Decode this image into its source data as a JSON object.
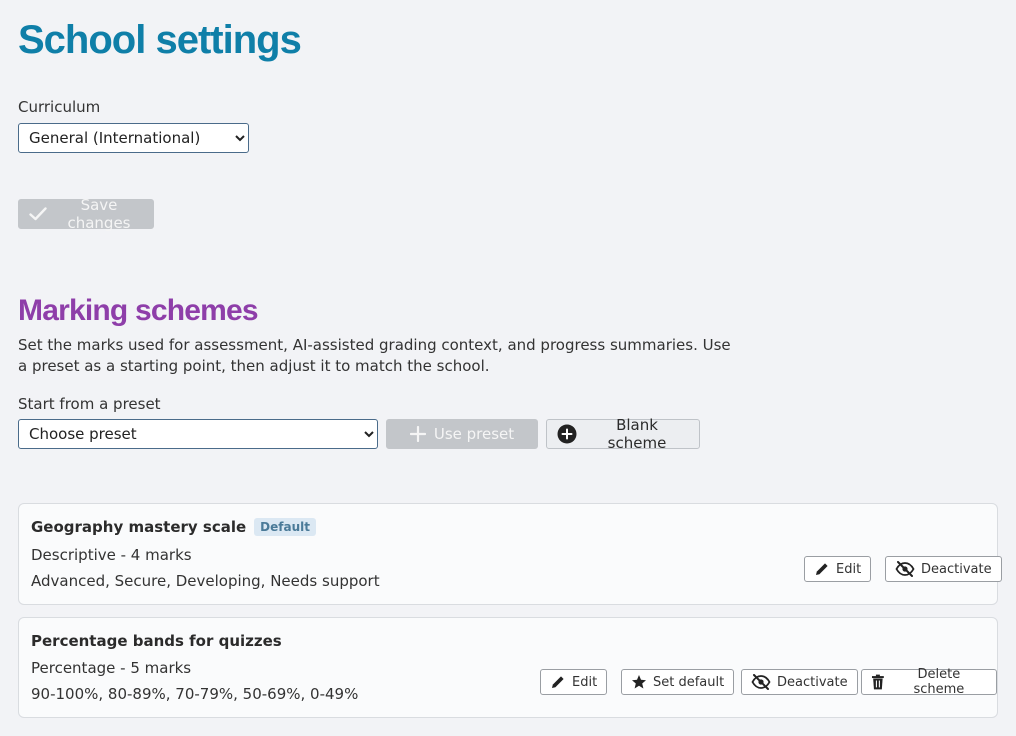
{
  "page": {
    "title": "School settings"
  },
  "curriculum": {
    "label": "Curriculum",
    "selected": "General (International)"
  },
  "save_button": {
    "label": "Save changes"
  },
  "marking": {
    "title": "Marking schemes",
    "description": "Set the marks used for assessment, AI-assisted grading context, and progress summaries. Use a preset as a starting point, then adjust it to match the school.",
    "preset_label": "Start from a preset",
    "preset_selected": "Choose preset",
    "use_preset_label": "Use preset",
    "blank_scheme_label": "Blank scheme"
  },
  "schemes": [
    {
      "name": "Geography mastery scale",
      "badge": "Default",
      "type": "Descriptive - 4 marks",
      "marks": "Advanced, Secure, Developing, Needs support",
      "edit_label": "Edit",
      "deactivate_label": "Deactivate"
    },
    {
      "name": "Percentage bands for quizzes",
      "type": "Percentage - 5 marks",
      "marks": "90-100%, 80-89%, 70-79%, 50-69%, 0-49%",
      "edit_label": "Edit",
      "set_default_label": "Set default",
      "deactivate_label": "Deactivate",
      "delete_label": "Delete scheme"
    }
  ],
  "colors": {
    "title": "#0f7fa8",
    "section_title": "#8e3ea9",
    "background": "#f2f3f6",
    "badge_bg": "#dbe8f3"
  },
  "icons": {
    "save": "check-icon",
    "use_preset": "plus-icon",
    "blank_scheme": "plus-circle-icon",
    "edit": "pencil-icon",
    "deactivate": "eye-slash-icon",
    "set_default": "star-icon",
    "delete": "trash-icon"
  }
}
